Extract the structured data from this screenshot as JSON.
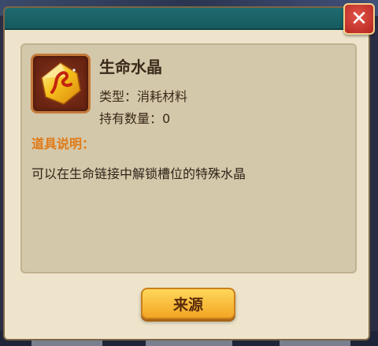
{
  "dialog": {
    "close_icon": "close-icon"
  },
  "item": {
    "icon": "life-crystal-icon",
    "name": "生命水晶",
    "type_label": "类型：",
    "type_value": "消耗材料",
    "count_label": "持有数量：",
    "count_value": "0"
  },
  "description": {
    "heading": "道具说明：",
    "text": "可以在生命链接中解锁槽位的特殊水晶"
  },
  "buttons": {
    "source_label": "来源"
  },
  "colors": {
    "title_bar": "#1f6b6f",
    "heading_accent": "#e07a18",
    "button_gold": "#f3a524",
    "close_red": "#c62d25"
  }
}
